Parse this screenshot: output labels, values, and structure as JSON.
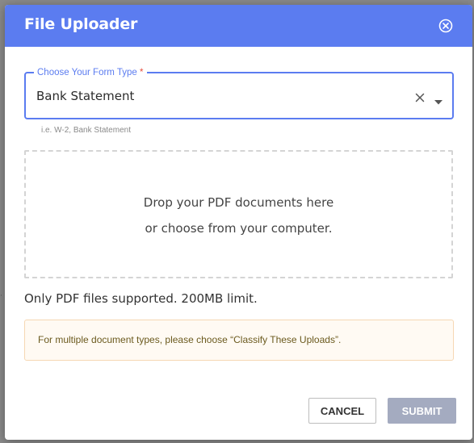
{
  "dialog": {
    "title": "File Uploader",
    "close_icon": "close-circle-icon"
  },
  "form_type": {
    "label": "Choose Your Form Type",
    "required_mark": "*",
    "value": "Bank Statement",
    "clear_icon": "clear-x-icon",
    "dropdown_icon": "caret-down-icon",
    "helper": "i.e. W-2, Bank Statement"
  },
  "dropzone": {
    "line1": "Drop your PDF documents here",
    "line2": "or choose from your computer."
  },
  "support_note": "Only PDF files supported. 200MB limit.",
  "alert": {
    "text": "For multiple document types, please choose “Classify These Uploads”."
  },
  "actions": {
    "cancel_label": "CANCEL",
    "submit_label": "SUBMIT"
  },
  "colors": {
    "header": "#5b7cf0",
    "accent": "#5b7cf0",
    "submit_disabled": "#a4abc0",
    "alert_bg": "#fffaf3",
    "alert_border": "#f6d7b3"
  }
}
